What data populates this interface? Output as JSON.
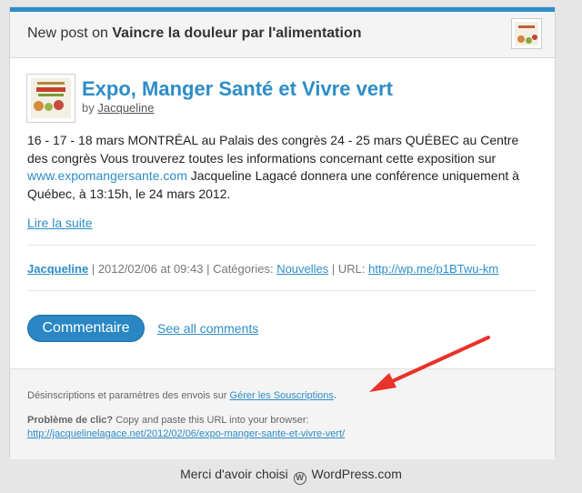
{
  "header": {
    "prefix": "New post on",
    "blog_name": "Vaincre la douleur par l'alimentation"
  },
  "post": {
    "title": "Expo, Manger Santé et Vivre vert",
    "by_label": "by",
    "author": "Jacqueline",
    "excerpt_before_link": "16 - 17 - 18 mars MONTRÉAL au Palais des congrès 24 - 25 mars QUÉBEC au Centre des congrès Vous trouverez toutes les informations concernant cette exposition sur",
    "excerpt_link": "www.expomangersante.com",
    "excerpt_after_link": "Jacqueline Lagacé donnera une conférence uniquement à Québec, à 13:15h,  le 24 mars 2012.",
    "read_more": "Lire la suite"
  },
  "meta": {
    "author": "Jacqueline",
    "date_text": "| 2012/02/06 at 09:43 | Catégories:",
    "category": "Nouvelles",
    "url_label": "| URL:",
    "short_url": "http://wp.me/p1BTwu-km"
  },
  "actions": {
    "comment_button": "Commentaire",
    "see_all": "See all comments"
  },
  "footer": {
    "unsub_text": "Désinscriptions et paramètres des envois sur",
    "unsub_link": "Gérer les Souscriptions",
    "unsub_period": ".",
    "problem_label": "Problème de clic?",
    "problem_text": "Copy and paste this URL into your browser:",
    "post_url": "http://jacquelinelagace.net/2012/02/06/expo-manger-sante-et-vivre-vert/"
  },
  "thanks": {
    "before": "Merci d'avoir choisi",
    "logo_glyph": "W",
    "brand": "WordPress.com"
  },
  "colors": {
    "accent": "#2d8dc7",
    "arrow": "#e8322a"
  }
}
